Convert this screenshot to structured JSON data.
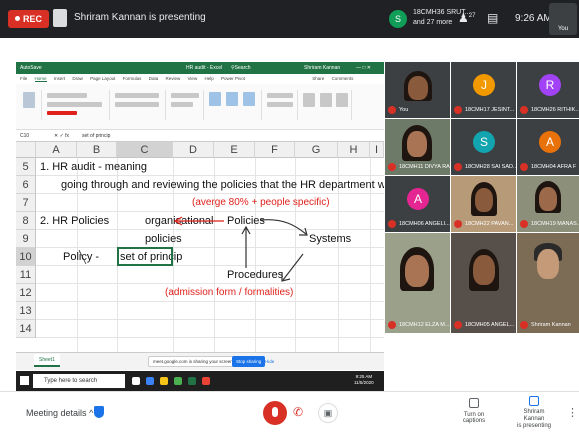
{
  "topbar": {
    "rec_label": "REC",
    "presenter_text": "Shriram Kannan is presenting",
    "participants_badge": "S",
    "participants_text_line1": "18CMH36 SRUT...",
    "participants_text_line2": "and 27 more",
    "people_count": "27",
    "clock": "9:26 AM",
    "you_label": "You"
  },
  "excel": {
    "title": "HR audit - Excel",
    "search_hint": "Search",
    "user": "Shriram Kannan",
    "tabs": [
      "AutoSave",
      "Home",
      "Insert",
      "Draw",
      "Page Layout",
      "Formulas",
      "Data",
      "Review",
      "View",
      "Help",
      "Power Pivot"
    ],
    "share": "Share",
    "comments": "Comments",
    "name_box": "C10",
    "formula": "set of princip",
    "columns": [
      "A",
      "B",
      "C",
      "D",
      "E",
      "F",
      "G",
      "H",
      "I"
    ],
    "rows": [
      "5",
      "6",
      "7",
      "8",
      "9",
      "10",
      "11",
      "12",
      "13",
      "14"
    ],
    "cells": {
      "r5": "1. HR audit - meaning",
      "r6": "going through and reviewing the policies that the HR department works with",
      "r7": "(averge 80% + people specific)",
      "r8a": "2. HR Policies",
      "r8b": "organisational",
      "r8c": "Policies",
      "r9a": "policies",
      "r9b": "Systems",
      "r10a": "Policy -",
      "r10b": "set of princip",
      "r11": "Procedures",
      "r12": "(admission form / formalities)"
    },
    "sheet_tab": "Sheet1",
    "share_notice": "meet.google.com is sharing your screen.",
    "stop_sharing": "Stop sharing",
    "hide": "Hide"
  },
  "taskbar": {
    "search_placeholder": "Type here to search",
    "time": "9:25 AM",
    "date": "11/5/2020"
  },
  "participants": [
    {
      "name": "You",
      "initial": "",
      "color": ""
    },
    {
      "name": "18CMH17 JESINT...",
      "initial": "J",
      "color": "#f29900"
    },
    {
      "name": "18CMH26 RITHIK...",
      "initial": "R",
      "color": "#a142f4"
    },
    {
      "name": "18CMH11 DIVYA RA...",
      "initial": "",
      "color": ""
    },
    {
      "name": "18CMH28 SAI SAD...",
      "initial": "S",
      "color": "#12a4af"
    },
    {
      "name": "18CMH04 AFRA F",
      "initial": "A",
      "color": "#e8710a"
    },
    {
      "name": "18CMH06 ANGELI...",
      "initial": "A",
      "color": "#e52592"
    },
    {
      "name": "18CMH22 PAVAN...",
      "initial": "",
      "color": ""
    },
    {
      "name": "18CMH19 MANAS...",
      "initial": "",
      "color": ""
    },
    {
      "name": "18CMH12 ELZA M...",
      "initial": "",
      "color": ""
    },
    {
      "name": "18CMH05 ANGEL...",
      "initial": "",
      "color": ""
    },
    {
      "name": "Shriram Kannan",
      "initial": "",
      "color": ""
    }
  ],
  "bottombar": {
    "meeting_details": "Meeting details",
    "captions": "Turn on captions",
    "presenting_line1": "Shriram Kannan",
    "presenting_line2": "is presenting"
  }
}
